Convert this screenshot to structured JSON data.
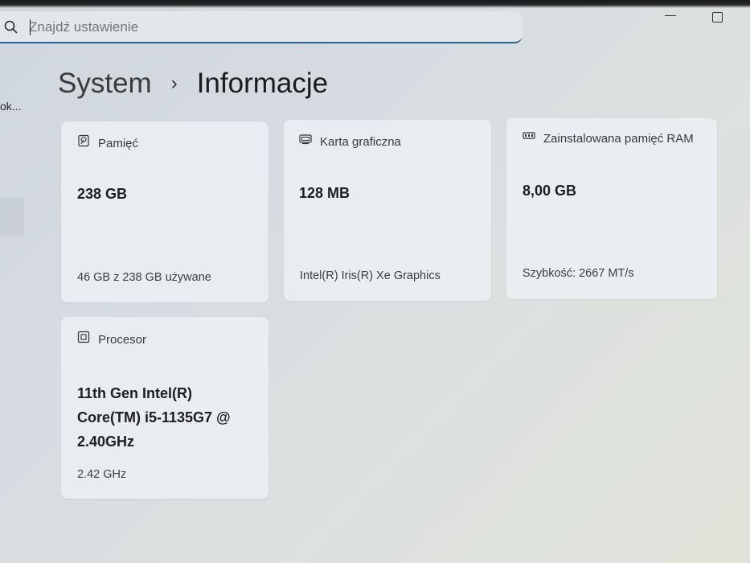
{
  "search": {
    "placeholder": "Znajdź ustawienie"
  },
  "sidebar": {
    "truncated_item": "ok..."
  },
  "breadcrumb": {
    "root": "System",
    "separator": "›",
    "current": "Informacje"
  },
  "cards": {
    "storage": {
      "icon": "storage-icon",
      "title": "Pamięć",
      "value": "238 GB",
      "detail": "46 GB z 238 GB używane"
    },
    "gpu": {
      "icon": "gpu-icon",
      "title": "Karta graficzna",
      "value": "128 MB",
      "detail": "Intel(R) Iris(R) Xe Graphics"
    },
    "ram": {
      "icon": "ram-icon",
      "title": "Zainstalowana pamięć RAM",
      "value": "8,00 GB",
      "detail": "Szybkość: 2667 MT/s"
    },
    "cpu": {
      "icon": "processor-icon",
      "title": "Procesor",
      "value": "11th Gen Intel(R) Core(TM) i5-1135G7 @ 2.40GHz",
      "detail": "2.42 GHz"
    }
  }
}
